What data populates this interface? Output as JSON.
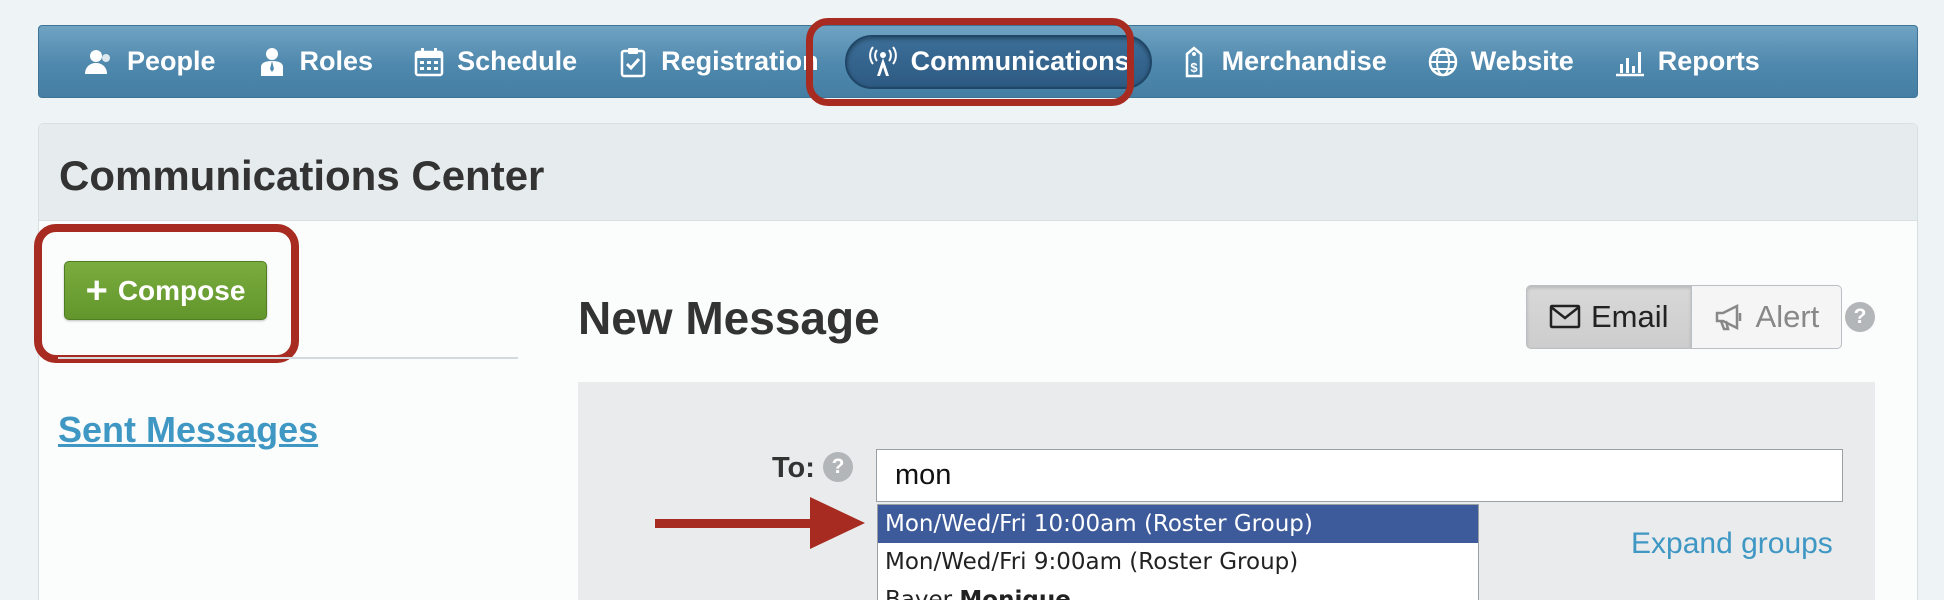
{
  "nav": {
    "items": [
      {
        "label": "People",
        "icon": "people-icon"
      },
      {
        "label": "Roles",
        "icon": "roles-icon"
      },
      {
        "label": "Schedule",
        "icon": "calendar-icon"
      },
      {
        "label": "Registration",
        "icon": "clipboard-check-icon"
      },
      {
        "label": "Communications",
        "icon": "broadcast-tower-icon",
        "active": true
      },
      {
        "label": "Merchandise",
        "icon": "price-tag-icon"
      },
      {
        "label": "Website",
        "icon": "globe-icon"
      },
      {
        "label": "Reports",
        "icon": "bar-chart-icon"
      }
    ]
  },
  "page": {
    "title": "Communications Center"
  },
  "sidebar": {
    "compose_label": "Compose",
    "sent_messages_label": "Sent Messages"
  },
  "message": {
    "title": "New Message",
    "type_toggle": {
      "email_label": "Email",
      "alert_label": "Alert",
      "selected": "Email"
    },
    "to_label": "To:",
    "to_value": "mon",
    "expand_groups_label": "Expand groups",
    "suggestions": [
      {
        "text": "Mon/Wed/Fri 10:00am (Roster Group)",
        "selected": true
      },
      {
        "text": "Mon/Wed/Fri 9:00am (Roster Group)",
        "selected": false
      },
      {
        "prefix": "Bayer, ",
        "bold": "Monique",
        "selected": false
      }
    ]
  },
  "annotations": {
    "callout_color": "#a72b20",
    "arrow_color": "#a72b20"
  },
  "colors": {
    "nav_bg": "#4f88ad",
    "compose_green": "#6b9f34",
    "link_blue": "#3f97c4",
    "dropdown_selected": "#3d5a9a"
  }
}
